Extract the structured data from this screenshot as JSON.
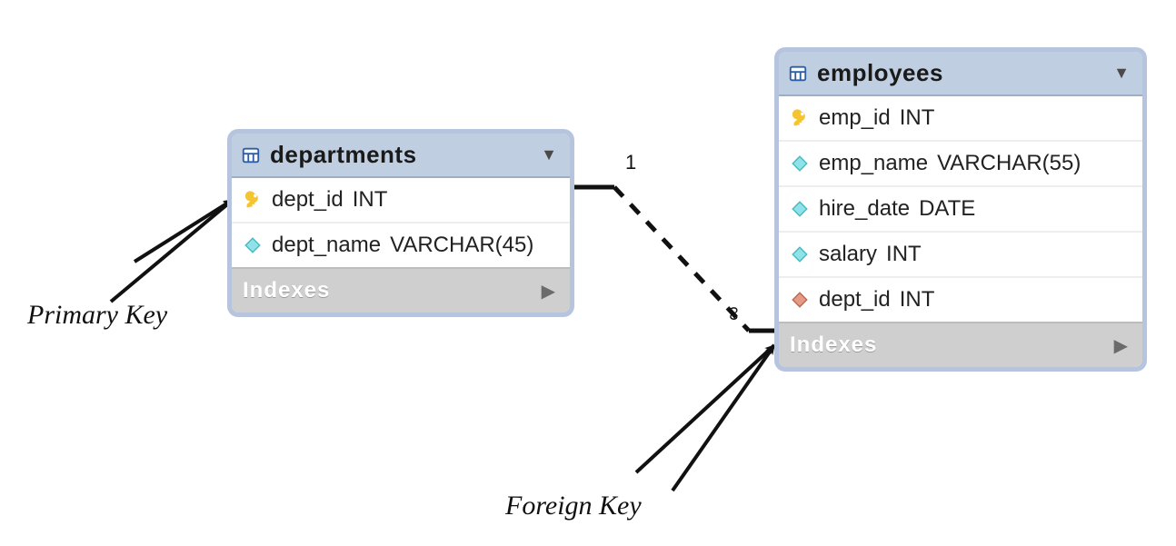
{
  "tables": {
    "departments": {
      "name": "departments",
      "columns": [
        {
          "name": "dept_id",
          "type": "INT",
          "key": "pk"
        },
        {
          "name": "dept_name",
          "type": "VARCHAR(45)",
          "key": "col"
        }
      ],
      "indexes_label": "Indexes"
    },
    "employees": {
      "name": "employees",
      "columns": [
        {
          "name": "emp_id",
          "type": "INT",
          "key": "pk"
        },
        {
          "name": "emp_name",
          "type": "VARCHAR(55)",
          "key": "col"
        },
        {
          "name": "hire_date",
          "type": "DATE",
          "key": "col"
        },
        {
          "name": "salary",
          "type": "INT",
          "key": "col"
        },
        {
          "name": "dept_id",
          "type": "INT",
          "key": "fk"
        }
      ],
      "indexes_label": "Indexes"
    }
  },
  "relationship": {
    "from_table": "departments",
    "from_column": "dept_id",
    "to_table": "employees",
    "to_column": "dept_id",
    "from_cardinality": "1",
    "to_cardinality": "∞"
  },
  "annotations": {
    "primary_key_label": "Primary Key",
    "foreign_key_label": "Foreign Key"
  }
}
